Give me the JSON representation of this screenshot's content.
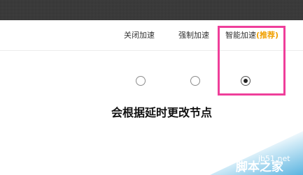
{
  "speed_options": [
    {
      "label": "关闭加速",
      "selected": false
    },
    {
      "label": "强制加速",
      "selected": false
    },
    {
      "label": "智能加速",
      "badge": "(推荐)",
      "selected": true
    }
  ],
  "note": "会根据延时更改节点",
  "watermark": {
    "site": "jb51.net",
    "name": "脚本之家"
  },
  "colors": {
    "highlight_border": "#ef3e9a",
    "recommend_badge": "#f0a000",
    "watermark_blue": "#5bb4e0"
  }
}
